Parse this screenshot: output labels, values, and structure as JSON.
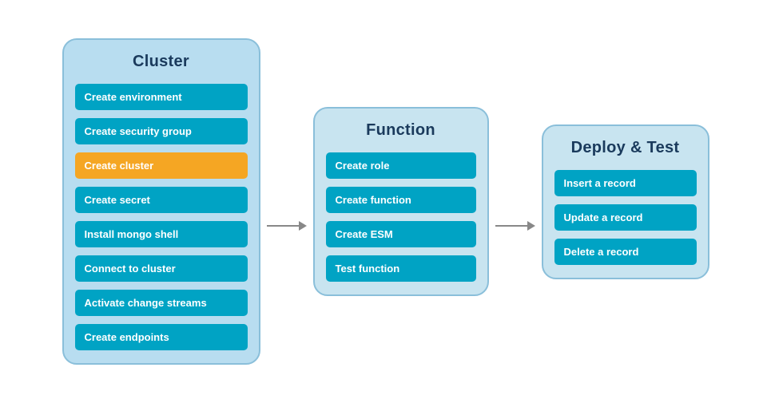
{
  "panels": {
    "cluster": {
      "title": "Cluster",
      "items": [
        {
          "label": "Create environment",
          "highlight": false
        },
        {
          "label": "Create security group",
          "highlight": false
        },
        {
          "label": "Create cluster",
          "highlight": true
        },
        {
          "label": "Create secret",
          "highlight": false
        },
        {
          "label": "Install mongo shell",
          "highlight": false
        },
        {
          "label": "Connect to cluster",
          "highlight": false
        },
        {
          "label": "Activate change streams",
          "highlight": false
        },
        {
          "label": "Create endpoints",
          "highlight": false
        }
      ]
    },
    "function": {
      "title": "Function",
      "items": [
        {
          "label": "Create role",
          "highlight": false
        },
        {
          "label": "Create function",
          "highlight": false
        },
        {
          "label": "Create ESM",
          "highlight": false
        },
        {
          "label": "Test function",
          "highlight": false
        }
      ]
    },
    "deploy": {
      "title": "Deploy & Test",
      "items": [
        {
          "label": "Insert a record",
          "highlight": false
        },
        {
          "label": "Update a record",
          "highlight": false
        },
        {
          "label": "Delete a record",
          "highlight": false
        }
      ]
    }
  },
  "colors": {
    "teal": "#00a3c4",
    "orange": "#f5a623",
    "arrow": "#888888"
  }
}
